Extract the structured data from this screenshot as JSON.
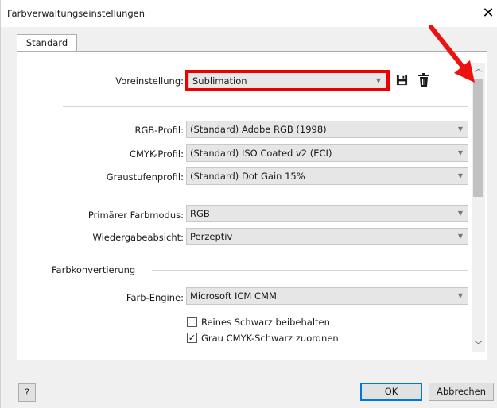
{
  "window": {
    "title": "Farbverwaltungseinstellungen",
    "close_glyph": "✕"
  },
  "tabs": [
    {
      "label": "Standard",
      "active": true
    }
  ],
  "preset": {
    "label": "Voreinstellung:",
    "value": "Sublimation",
    "highlight_color": "#ee0000"
  },
  "profiles": [
    {
      "label": "RGB-Profil:",
      "value": "(Standard) Adobe RGB (1998)"
    },
    {
      "label": "CMYK-Profil:",
      "value": "(Standard) ISO Coated v2 (ECI)"
    },
    {
      "label": "Graustufenprofil:",
      "value": "(Standard) Dot Gain 15%"
    }
  ],
  "modes": [
    {
      "label": "Primärer Farbmodus:",
      "value": "RGB"
    },
    {
      "label": "Wiedergabeabsicht:",
      "value": "Perzeptiv"
    }
  ],
  "conversion": {
    "heading": "Farbkonvertierung",
    "engine_label": "Farb-Engine:",
    "engine_value": "Microsoft ICM CMM",
    "checkboxes": [
      {
        "label": "Reines Schwarz beibehalten",
        "checked": false
      },
      {
        "label": "Grau CMYK-Schwarz zuordnen",
        "checked": true
      }
    ]
  },
  "footer": {
    "help_label": "?",
    "ok_label": "OK",
    "cancel_label": "Abbrechen"
  },
  "icons": {
    "save": "save-icon",
    "delete": "trash-icon",
    "dropdown": "chevron-down-icon"
  },
  "annotation": {
    "arrow_color": "#ee1111"
  }
}
